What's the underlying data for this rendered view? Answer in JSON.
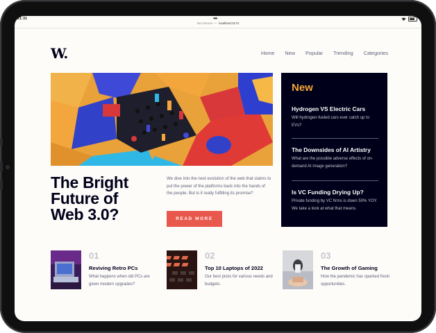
{
  "status": {
    "time": "21:31",
    "dots": "•••",
    "battery": "100%"
  },
  "browser": {
    "secure_label": "Not Secure —",
    "host": "localhost:3173"
  },
  "logo": "W.",
  "nav": {
    "items": [
      "Home",
      "New",
      "Popular",
      "Trending",
      "Categories"
    ]
  },
  "hero": {
    "title_lines": [
      "The Bright",
      "Future of",
      "Web 3.0?"
    ],
    "description": "We dive into the next evolution of the web that claims to put the power of the platforms back into the hands of the people. But is it really fulfilling its promise?",
    "button": "READ MORE"
  },
  "new_section": {
    "heading": "New",
    "items": [
      {
        "title": "Hydrogen VS Electric Cars",
        "desc": "Will hydrogen-fueled cars ever catch up to EVs?"
      },
      {
        "title": "The Downsides of AI Artistry",
        "desc": "What are the possible adverse effects of on-demand AI image generation?"
      },
      {
        "title": "Is VC Funding Drying Up?",
        "desc": "Private funding by VC firms is down 50% YOY. We take a look at what that means."
      }
    ]
  },
  "cards": [
    {
      "num": "01",
      "title": "Reviving Retro PCs",
      "desc": "What happens when old PCs are given modern upgrades?"
    },
    {
      "num": "02",
      "title": "Top 10 Laptops of 2022",
      "desc": "Our best picks for various needs and budgets."
    },
    {
      "num": "03",
      "title": "The Growth of Gaming",
      "desc": "How the pandemic has sparked fresh opportunities."
    }
  ],
  "colors": {
    "accent": "#e9584c",
    "dark": "#00001a",
    "orange": "#f3a63b",
    "muted": "#5d5f79",
    "background": "#fdfcf9"
  }
}
